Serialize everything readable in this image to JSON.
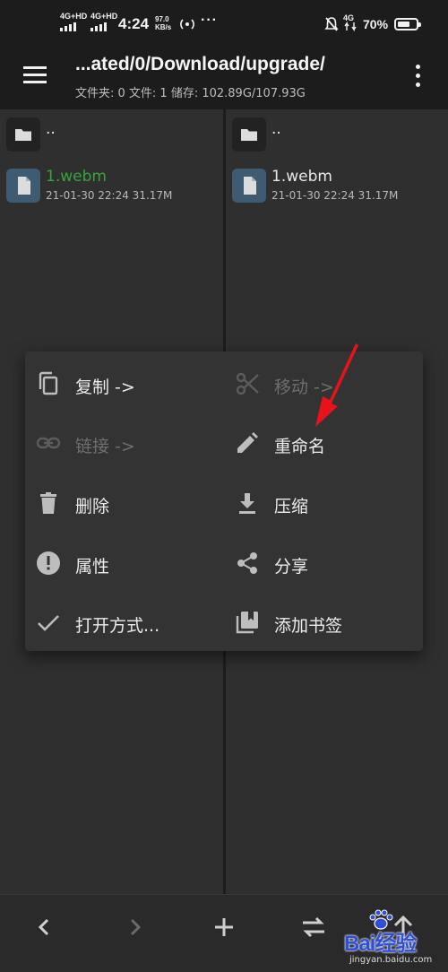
{
  "status_bar": {
    "sim1": "4G+HD",
    "sim2": "4G+HD",
    "time": "4:24",
    "speed_value": "97.0",
    "speed_unit": "KB/s",
    "net": "4G",
    "battery": "70%",
    "battery_level": 0.7
  },
  "app_bar": {
    "path": "...ated/0/Download/upgrade/",
    "info": "文件夹: 0  文件: 1  储存: 102.89G/107.93G"
  },
  "left_pane": {
    "parent": "..",
    "files": [
      {
        "name": "1.webm",
        "meta": "21-01-30 22:24  31.17M",
        "selected": true
      }
    ]
  },
  "right_pane": {
    "parent": "..",
    "files": [
      {
        "name": "1.webm",
        "meta": "21-01-30 22:24  31.17M"
      }
    ]
  },
  "context_menu": {
    "copy": "复制 ->",
    "move": "移动 ->",
    "link": "链接 ->",
    "rename": "重命名",
    "delete": "删除",
    "compress": "压缩",
    "properties": "属性",
    "share": "分享",
    "open_with": "打开方式...",
    "add_bookmark": "添加书签"
  },
  "watermark": {
    "brand": "Bai经验",
    "site": "jingyan.baidu.com"
  },
  "colors": {
    "highlight_green": "#35a53a",
    "file_icon_bg": "#3f5b72",
    "annotation_red": "#e8121a"
  }
}
